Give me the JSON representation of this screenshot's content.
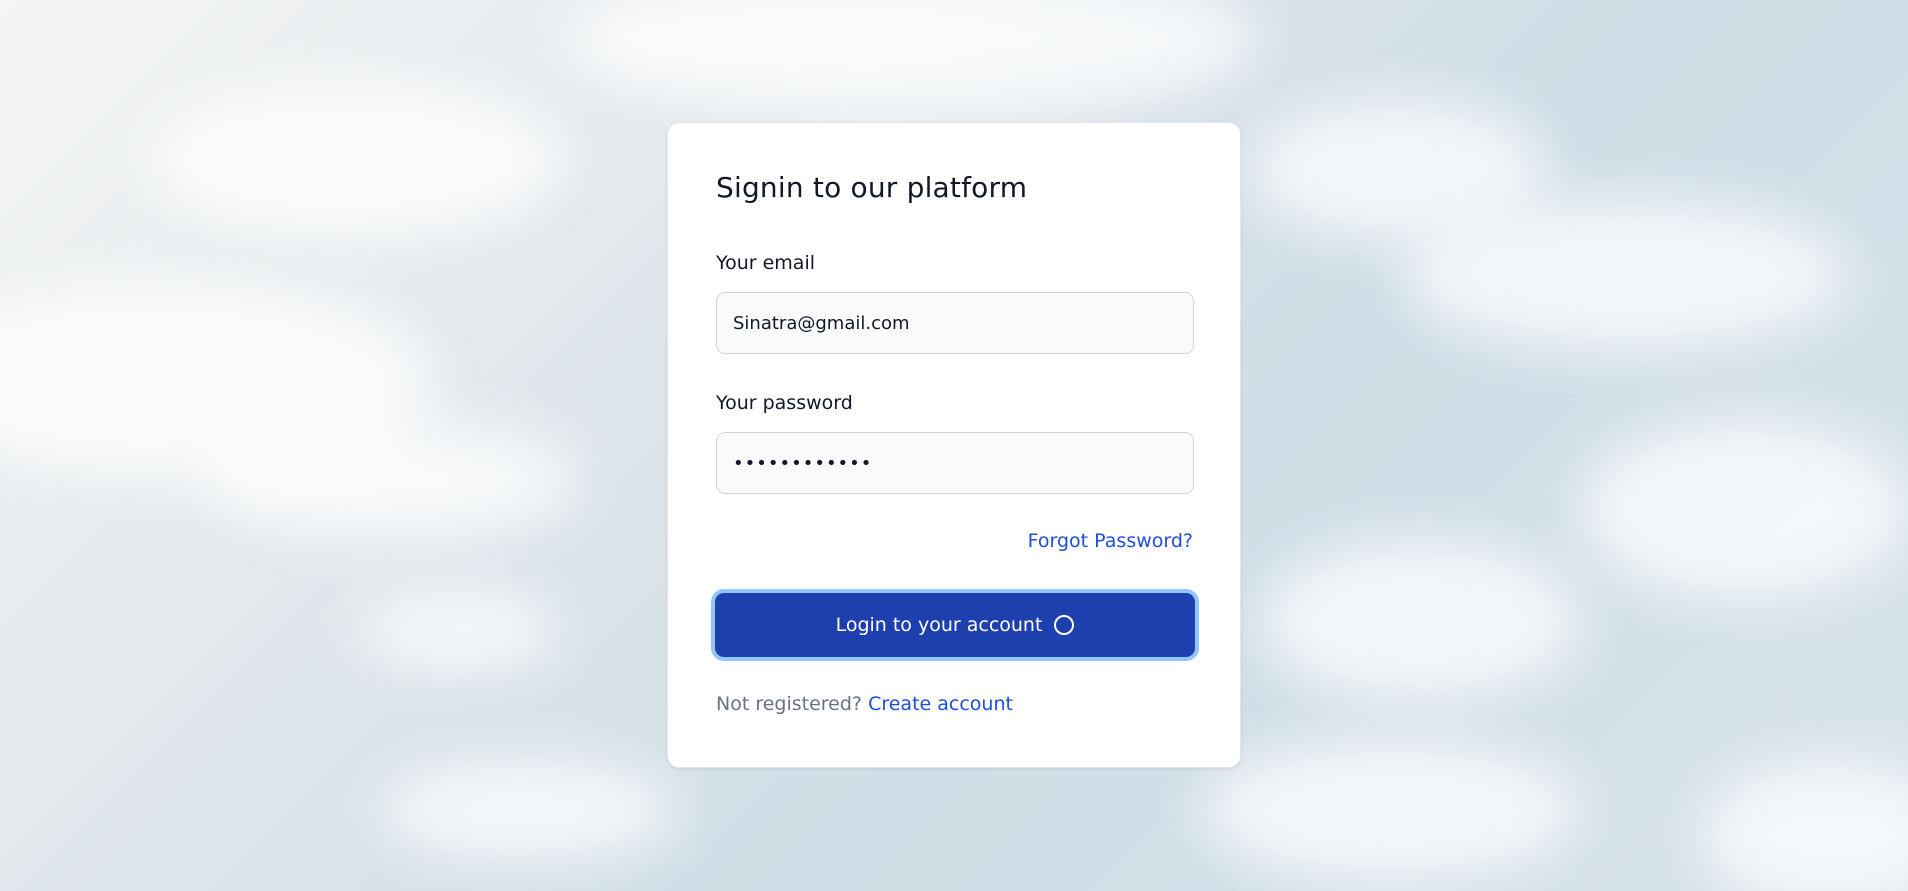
{
  "form": {
    "title": "Signin to our platform",
    "email_label": "Your email",
    "email_value": "Sinatra@gmail.com",
    "password_label": "Your password",
    "password_value": "••••••••••••",
    "forgot_password_link": "Forgot Password?",
    "login_button_label": "Login to your account",
    "login_button_state": "loading",
    "not_registered_text": "Not registered?",
    "create_account_link": "Create account"
  },
  "colors": {
    "primary_button": "#1e40af",
    "button_focus_ring": "#93c5fd",
    "link": "#1d4ed8",
    "muted_text": "#6b7280",
    "input_background": "#f9fafb"
  },
  "icons": {
    "button_spinner": "loading-spinner-icon"
  }
}
